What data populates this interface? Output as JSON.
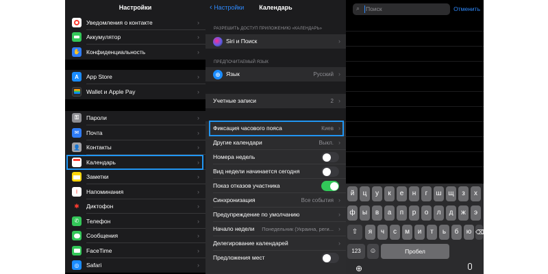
{
  "settings": {
    "title": "Настройки",
    "items": [
      {
        "label": "Уведомления о контакте",
        "icon": "exposure-notification-icon",
        "color": "#ffffff"
      },
      {
        "label": "Аккумулятор",
        "icon": "battery-icon",
        "color": "#34c759"
      },
      {
        "label": "Конфиденциальность",
        "icon": "privacy-hand-icon",
        "color": "#2f7cf6"
      },
      {
        "label": "App Store",
        "icon": "app-store-icon",
        "color": "#1a8cff"
      },
      {
        "label": "Wallet и Apple Pay",
        "icon": "wallet-icon",
        "color": "#2c2c2e"
      },
      {
        "label": "Пароли",
        "icon": "key-icon",
        "color": "#8e8e93"
      },
      {
        "label": "Почта",
        "icon": "mail-icon",
        "color": "#2f7cf6"
      },
      {
        "label": "Контакты",
        "icon": "contacts-icon",
        "color": "#a2a2a7"
      },
      {
        "label": "Календарь",
        "icon": "calendar-icon",
        "color": "#ffffff"
      },
      {
        "label": "Заметки",
        "icon": "notes-icon",
        "color": "#ffd60a"
      },
      {
        "label": "Напоминания",
        "icon": "reminders-icon",
        "color": "#ffffff"
      },
      {
        "label": "Диктофон",
        "icon": "voice-memos-icon",
        "color": "#1c1c1e"
      },
      {
        "label": "Телефон",
        "icon": "phone-icon",
        "color": "#34c759"
      },
      {
        "label": "Сообщения",
        "icon": "messages-icon",
        "color": "#34c759"
      },
      {
        "label": "FaceTime",
        "icon": "facetime-icon",
        "color": "#34c759"
      },
      {
        "label": "Safari",
        "icon": "safari-icon",
        "color": "#1a8cff"
      }
    ]
  },
  "calendar": {
    "back_label": "Настройки",
    "title": "Календарь",
    "access_header": "РАЗРЕШИТЬ ДОСТУП ПРИЛОЖЕНИЮ «КАЛЕНДАРЬ»",
    "siri_label": "Siri и Поиск",
    "lang_header": "ПРЕДПОЧИТАЕМЫЙ ЯЗЫК",
    "lang_label": "Язык",
    "lang_value": "Русский",
    "accounts_label": "Учетные записи",
    "accounts_value": "2",
    "tz_label": "Фиксация часового пояса",
    "tz_value": "Киев",
    "other_label": "Другие календари",
    "other_value": "Выкл.",
    "week_numbers_label": "Номера недель",
    "week_start_today_label": "Вид недели начинается сегодня",
    "declined_label": "Показ отказов участника",
    "sync_label": "Синхронизация",
    "sync_value": "Все события",
    "alert_label": "Предупреждение по умолчанию",
    "week_start_label": "Начало недели",
    "week_start_value": "Понедельник (Украина, реги...",
    "delegation_label": "Делегирование календарей",
    "location_label": "Предложения мест",
    "toggles": {
      "week_numbers": false,
      "week_start_today": false,
      "declined": true,
      "location": false
    }
  },
  "search": {
    "placeholder": "Поиск",
    "cancel_label": "Отменить"
  },
  "keyboard": {
    "row1": [
      "й",
      "ц",
      "у",
      "к",
      "е",
      "н",
      "г",
      "ш",
      "щ",
      "з",
      "х"
    ],
    "row2": [
      "ф",
      "ы",
      "в",
      "а",
      "п",
      "р",
      "о",
      "л",
      "д",
      "ж",
      "э"
    ],
    "row3": [
      "я",
      "ч",
      "с",
      "м",
      "и",
      "т",
      "ь",
      "б",
      "ю"
    ],
    "shift_icon": "shift-icon",
    "backspace_icon": "backspace-icon",
    "numbers_label": "123",
    "space_label": "Пробел",
    "emoji_icon": "emoji-icon",
    "globe_icon": "globe-icon",
    "mic_icon": "microphone-icon"
  },
  "colors": {
    "accent": "#2f8bff",
    "highlight": "#2196f3",
    "toggle_on": "#32c759"
  }
}
